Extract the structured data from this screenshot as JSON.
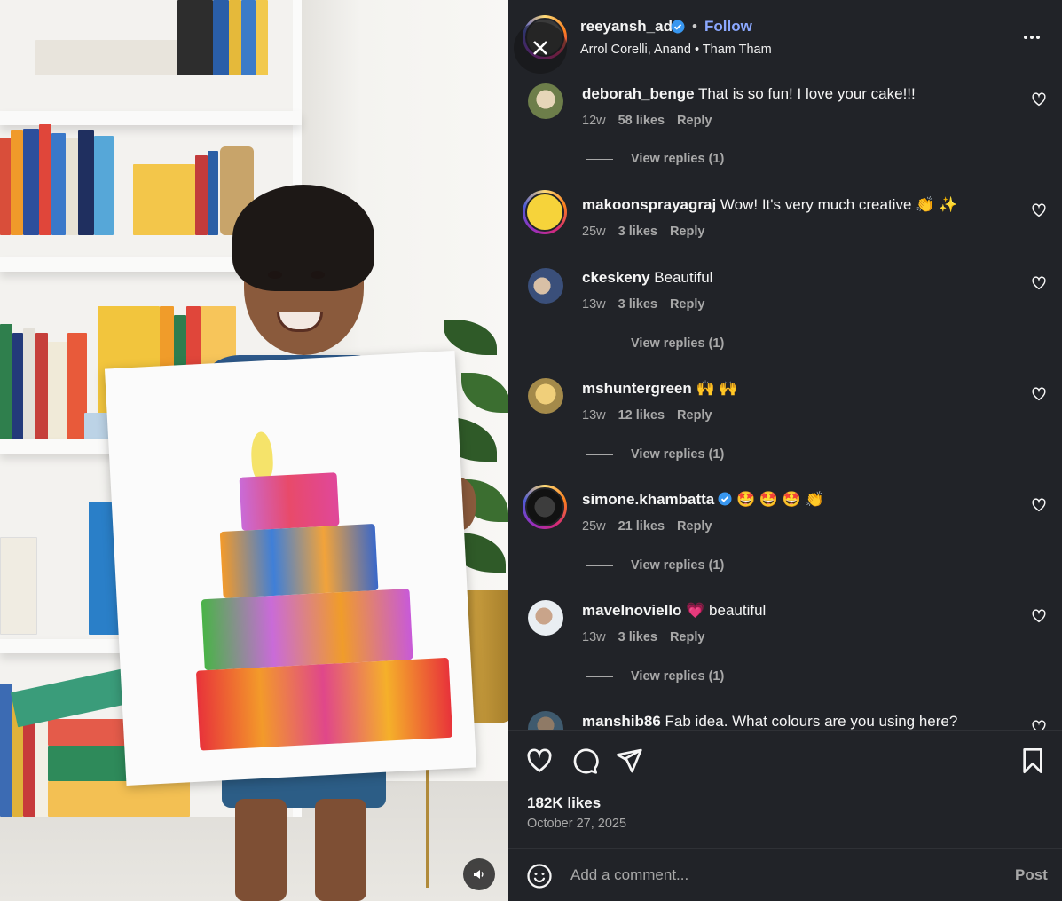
{
  "media": {
    "mute_icon": "speaker-icon"
  },
  "header": {
    "username": "reeyansh_ad",
    "dot": "•",
    "follow": "Follow",
    "audio": "Arrol Corelli, Anand • Tham Tham"
  },
  "comments": [
    {
      "user": "deborah_benge",
      "text": " That is so fun! I love your cake!!!",
      "age": "12w",
      "likes": "58 likes",
      "reply": "Reply",
      "view_replies": "View replies (1)"
    },
    {
      "user": "makoonsprayagraj",
      "text": " Wow! It's very much creative 👏 ✨",
      "age": "25w",
      "likes": "3 likes",
      "reply": "Reply"
    },
    {
      "user": "ckeskeny",
      "text": " Beautiful",
      "age": "13w",
      "likes": "3 likes",
      "reply": "Reply",
      "view_replies": "View replies (1)"
    },
    {
      "user": "mshuntergreen",
      "text": " 🙌 🙌",
      "age": "13w",
      "likes": "12 likes",
      "reply": "Reply",
      "view_replies": "View replies (1)"
    },
    {
      "user": "simone.khambatta",
      "text": " 🤩 🤩 🤩 👏",
      "age": "25w",
      "likes": "21 likes",
      "reply": "Reply",
      "view_replies": "View replies (1)",
      "verified": true
    },
    {
      "user": "mavelnoviello",
      "text": " 💗 beautiful",
      "age": "13w",
      "likes": "3 likes",
      "reply": "Reply",
      "view_replies": "View replies (1)"
    },
    {
      "user": "manshib86",
      "text": " Fab idea. What colours are you using here?"
    }
  ],
  "footer": {
    "likes": "182K likes",
    "date": "October 27, 2025"
  },
  "composer": {
    "placeholder": "Add a comment...",
    "post": "Post"
  },
  "colors": {
    "panel_bg": "#212328",
    "link_blue": "#8ba8ff",
    "muted": "#a8a8a8",
    "verified": "#3897f0"
  }
}
